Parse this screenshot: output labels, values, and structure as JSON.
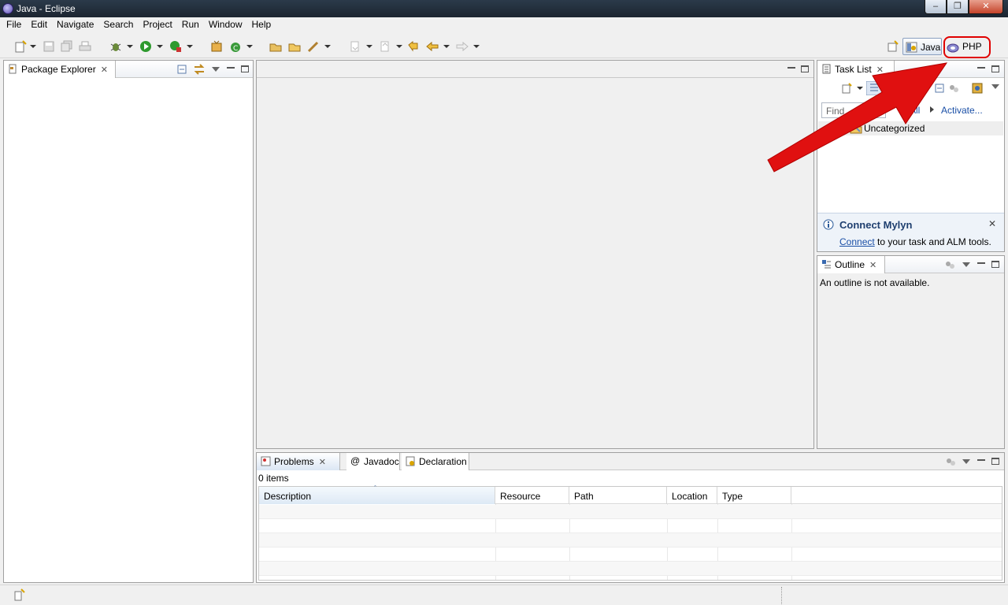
{
  "window": {
    "title": "Java - Eclipse"
  },
  "menu": [
    "File",
    "Edit",
    "Navigate",
    "Search",
    "Project",
    "Run",
    "Window",
    "Help"
  ],
  "perspectives": {
    "java": "Java",
    "php": "PHP"
  },
  "package_explorer": {
    "tab_label": "Package Explorer"
  },
  "task_list": {
    "tab_label": "Task List",
    "find_placeholder": "Find",
    "all_label": "All",
    "activate_label": "Activate...",
    "category": "Uncategorized"
  },
  "mylyn": {
    "title": "Connect Mylyn",
    "link": "Connect",
    "text": " to your task and ALM tools."
  },
  "outline": {
    "tab_label": "Outline",
    "message": "An outline is not available."
  },
  "bottom_tabs": [
    "Problems",
    "Javadoc",
    "Declaration"
  ],
  "problems": {
    "count": "0 items",
    "columns": [
      "Description",
      "Resource",
      "Path",
      "Location",
      "Type"
    ]
  }
}
